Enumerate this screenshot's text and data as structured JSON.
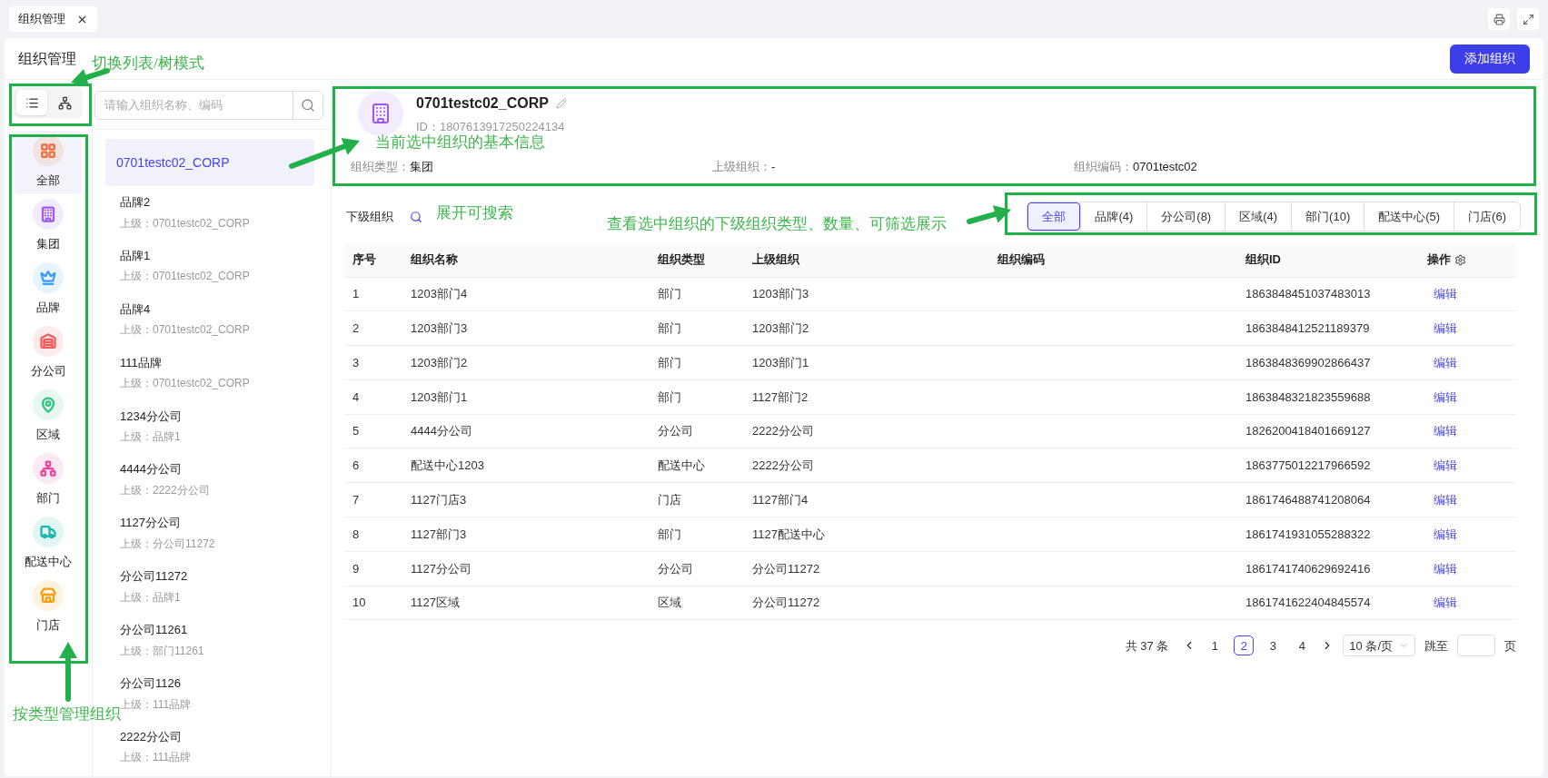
{
  "tab": {
    "title": "组织管理"
  },
  "page_title": "组织管理",
  "add_button": "添加组织",
  "view_modes": [
    {
      "kind": "list",
      "selected": true
    },
    {
      "kind": "tree",
      "selected": false
    }
  ],
  "search": {
    "placeholder": "请输入组织名称、编码"
  },
  "types": [
    {
      "kind": "all",
      "label": "全部",
      "color": "#f26b3a",
      "selected": true
    },
    {
      "kind": "group",
      "label": "集团",
      "color": "#9b59f0",
      "selected": false
    },
    {
      "kind": "brand",
      "label": "品牌",
      "color": "#3b9cf5",
      "selected": false
    },
    {
      "kind": "branch",
      "label": "分公司",
      "color": "#f05a5a",
      "selected": false
    },
    {
      "kind": "region",
      "label": "区域",
      "color": "#2ec27e",
      "selected": false
    },
    {
      "kind": "dept",
      "label": "部门",
      "color": "#ec4899",
      "selected": false
    },
    {
      "kind": "delivery",
      "label": "配送中心",
      "color": "#14b8a6",
      "selected": false
    },
    {
      "kind": "store",
      "label": "门店",
      "color": "#f59e0b",
      "selected": false
    }
  ],
  "org_list": [
    {
      "name": "0701testc02_CORP",
      "selected": true
    },
    {
      "name": "品牌2",
      "parent": "上级：0701testc02_CORP",
      "selected": false
    },
    {
      "name": "品牌1",
      "parent": "上级：0701testc02_CORP",
      "selected": false
    },
    {
      "name": "品牌4",
      "parent": "上级：0701testc02_CORP",
      "selected": false
    },
    {
      "name": "111品牌",
      "parent": "上级：0701testc02_CORP",
      "selected": false
    },
    {
      "name": "1234分公司",
      "parent": "上级：品牌1",
      "selected": false
    },
    {
      "name": "4444分公司",
      "parent": "上级：2222分公司",
      "selected": false
    },
    {
      "name": "1127分公司",
      "parent": "上级：分公司11272",
      "selected": false
    },
    {
      "name": "分公司11272",
      "parent": "上级：品牌1",
      "selected": false
    },
    {
      "name": "分公司11261",
      "parent": "上级：部门11261",
      "selected": false
    },
    {
      "name": "分公司1126",
      "parent": "上级：111品牌",
      "selected": false
    },
    {
      "name": "2222分公司",
      "parent": "上级：111品牌",
      "selected": false
    }
  ],
  "detail": {
    "name": "0701testc02_CORP",
    "id": "ID：1807613917250224134",
    "fields": [
      {
        "label": "组织类型：",
        "value": "集团"
      },
      {
        "label": "上级组织：",
        "value": "-"
      },
      {
        "label": "组织编码：",
        "value": "0701testc02"
      }
    ]
  },
  "sub": {
    "title": "下级组织",
    "filters": [
      {
        "label": "全部",
        "selected": true
      },
      {
        "label": "品牌(4)",
        "selected": false
      },
      {
        "label": "分公司(8)",
        "selected": false
      },
      {
        "label": "区域(4)",
        "selected": false
      },
      {
        "label": "部门(10)",
        "selected": false
      },
      {
        "label": "配送中心(5)",
        "selected": false
      },
      {
        "label": "门店(6)",
        "selected": false
      }
    ]
  },
  "table": {
    "columns": [
      "序号",
      "组织名称",
      "组织类型",
      "上级组织",
      "组织编码",
      "组织ID",
      "操作"
    ],
    "rows": [
      {
        "cells": [
          "1",
          "1203部门4",
          "部门",
          "1203部门3",
          "",
          "1863848451037483013"
        ],
        "action": "编辑"
      },
      {
        "cells": [
          "2",
          "1203部门3",
          "部门",
          "1203部门2",
          "",
          "1863848412521189379"
        ],
        "action": "编辑"
      },
      {
        "cells": [
          "3",
          "1203部门2",
          "部门",
          "1203部门1",
          "",
          "1863848369902866437"
        ],
        "action": "编辑"
      },
      {
        "cells": [
          "4",
          "1203部门1",
          "部门",
          "1127部门2",
          "",
          "1863848321823559688"
        ],
        "action": "编辑"
      },
      {
        "cells": [
          "5",
          "4444分公司",
          "分公司",
          "2222分公司",
          "",
          "1826200418401669127"
        ],
        "action": "编辑"
      },
      {
        "cells": [
          "6",
          "配送中心1203",
          "配送中心",
          "2222分公司",
          "",
          "1863775012217966592"
        ],
        "action": "编辑"
      },
      {
        "cells": [
          "7",
          "1127门店3",
          "门店",
          "1127部门4",
          "",
          "1861746488741208064"
        ],
        "action": "编辑"
      },
      {
        "cells": [
          "8",
          "1127部门3",
          "部门",
          "1127配送中心",
          "",
          "1861741931055288322"
        ],
        "action": "编辑"
      },
      {
        "cells": [
          "9",
          "1127分公司",
          "分公司",
          "分公司11272",
          "",
          "1861741740629692416"
        ],
        "action": "编辑"
      },
      {
        "cells": [
          "10",
          "1127区域",
          "区域",
          "分公司11272",
          "",
          "1861741622404845574"
        ],
        "action": "编辑"
      }
    ]
  },
  "pagination": {
    "total": "共 37 条",
    "pages": [
      {
        "label": "1",
        "selected": false
      },
      {
        "label": "2",
        "selected": true
      },
      {
        "label": "3",
        "selected": false
      },
      {
        "label": "4",
        "selected": false
      }
    ],
    "page_size": "10 条/页",
    "jump_label": "跳至",
    "page_suffix": "页"
  },
  "annotations": [
    {
      "kind": "view-toggle",
      "text": "切换列表/树模式"
    },
    {
      "kind": "detail",
      "text": "当前选中组织的基本信息"
    },
    {
      "kind": "search",
      "text": "展开可搜索"
    },
    {
      "kind": "filters",
      "text": "查看选中组织的下级组织类型、数量、可筛选展示"
    },
    {
      "kind": "types",
      "text": "按类型管理组织"
    }
  ]
}
